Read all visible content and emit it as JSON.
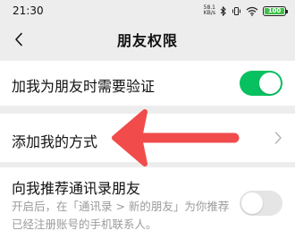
{
  "status_bar": {
    "time": "21:30",
    "net_speed_value": "58.1",
    "net_speed_unit": "KB/s",
    "battery_level": "100",
    "battery_color": "#3cc146",
    "icons": [
      "bluetooth-icon",
      "vibrate-icon",
      "wifi-icon",
      "battery-icon"
    ]
  },
  "nav": {
    "title": "朋友权限",
    "back_icon": "chevron-left-icon"
  },
  "settings": [
    {
      "label": "加我为朋友时需要验证",
      "control": "toggle",
      "checked": true
    },
    {
      "label": "添加我的方式",
      "control": "chevron"
    },
    {
      "label": "向我推荐通讯录朋友",
      "control": "toggle",
      "checked": false,
      "description": "开启后，在「通讯录 > 新的朋友」为你推荐已经注册账号的手机联系人。"
    }
  ],
  "colors": {
    "toggle_on": "#07c160",
    "toggle_off": "#e5e5e5",
    "annotation_arrow": "#f24b4b",
    "background": "#ededed"
  },
  "annotation": {
    "type": "arrow",
    "points_to": "添加我的方式",
    "icon": "red-arrow-icon"
  }
}
